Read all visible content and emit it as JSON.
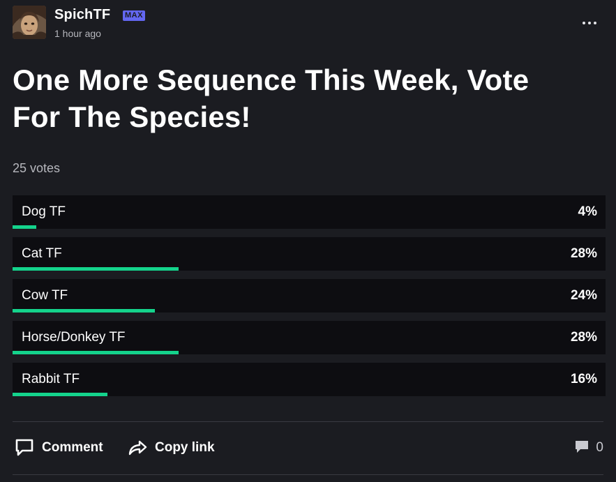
{
  "post": {
    "author": "SpichTF",
    "badge": "MAX",
    "timestamp": "1 hour ago",
    "title": "One More Sequence This Week, Vote For The Species!"
  },
  "poll": {
    "vote_count": "25 votes",
    "accent_color": "#14d38c",
    "options": [
      {
        "label": "Dog TF",
        "percent": "4%",
        "value": 4
      },
      {
        "label": "Cat TF",
        "percent": "28%",
        "value": 28
      },
      {
        "label": "Cow TF",
        "percent": "24%",
        "value": 24
      },
      {
        "label": "Horse/Donkey TF",
        "percent": "28%",
        "value": 28
      },
      {
        "label": "Rabbit TF",
        "percent": "16%",
        "value": 16
      }
    ]
  },
  "actions": {
    "comment_label": "Comment",
    "copy_link_label": "Copy link",
    "comment_count": "0",
    "icons": [
      "speech-bubble-icon",
      "share-arrow-icon",
      "comment-count-icon",
      "more-options-icon"
    ]
  }
}
